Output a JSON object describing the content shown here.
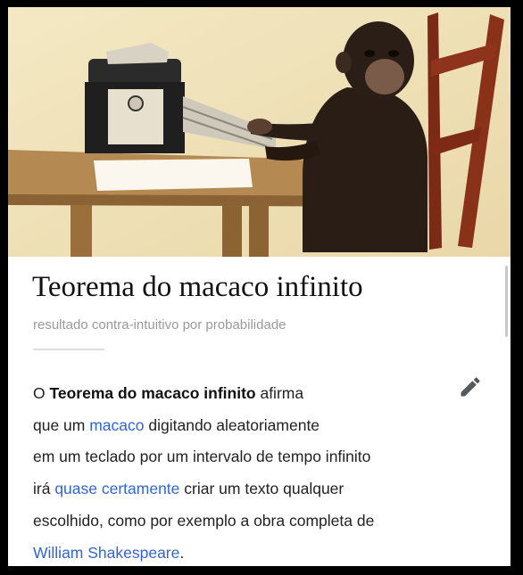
{
  "article": {
    "title": "Teorema do macaco infinito",
    "subtitle": "resultado contra-intuitivo por probabilidade",
    "paragraph": {
      "l1_pre": "O ",
      "l1_bold": "Teorema do macaco infinito",
      "l1_post": " afirma",
      "l2_pre": "que um ",
      "l2_link": "macaco",
      "l2_post": " digitando aleatoriamente",
      "l3": "em um teclado por um intervalo de tempo infinito",
      "l4_pre": "irá ",
      "l4_link": "quase certamente",
      "l4_post": " criar um texto qualquer",
      "l5": "escolhido, como por exemplo a obra completa de",
      "l6_link": "William Shakespeare",
      "l6_post": "."
    }
  },
  "icons": {
    "edit": "pencil-icon"
  },
  "colors": {
    "link": "#3366cc",
    "subtitle": "#9a9a9a",
    "background": "#000000"
  }
}
